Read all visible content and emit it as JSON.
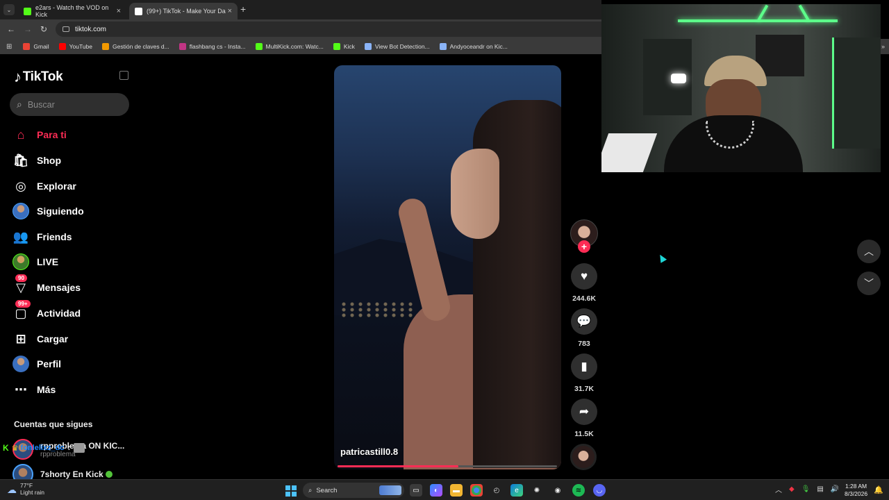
{
  "browser": {
    "tabs": [
      {
        "title": "e2ars - Watch the VOD on Kick",
        "favicon_color": "#53fc18"
      },
      {
        "title": "(99+) TikTok - Make Your Da",
        "favicon_color": "#ffffff"
      }
    ],
    "new_tab": "+",
    "close_glyph": "×",
    "url": "tiktok.com",
    "bookmarks": [
      {
        "label": "Gmail",
        "color": "#ea4335"
      },
      {
        "label": "YouTube",
        "color": "#ff0000"
      },
      {
        "label": "Gestión de claves d...",
        "color": "#f29900"
      },
      {
        "label": "flashbang cs - Insta...",
        "color": "#c13584"
      },
      {
        "label": "MultiKick.com: Watc...",
        "color": "#53fc18"
      },
      {
        "label": "Kick",
        "color": "#53fc18"
      },
      {
        "label": "View Bot Detection...",
        "color": "#8ab4f8"
      },
      {
        "label": "Andyoceandr on Kic...",
        "color": "#8ab4f8"
      }
    ]
  },
  "tiktok": {
    "logo": "TikTok",
    "search_placeholder": "Buscar",
    "nav": [
      {
        "label": "Para ti",
        "icon": "home-icon",
        "active": true
      },
      {
        "label": "Shop",
        "icon": "shop-icon"
      },
      {
        "label": "Explorar",
        "icon": "compass-icon"
      },
      {
        "label": "Siguiendo",
        "icon": "following-avatar-icon"
      },
      {
        "label": "Friends",
        "icon": "friends-icon"
      },
      {
        "label": "LIVE",
        "icon": "live-icon"
      },
      {
        "label": "Mensajes",
        "icon": "messages-icon",
        "badge": "90"
      },
      {
        "label": "Actividad",
        "icon": "activity-icon",
        "badge": "99+"
      },
      {
        "label": "Cargar",
        "icon": "upload-icon"
      },
      {
        "label": "Perfil",
        "icon": "profile-avatar-icon"
      },
      {
        "label": "Más",
        "icon": "more-icon"
      }
    ],
    "following_title": "Cuentas que sigues",
    "following": [
      {
        "name": "rpproblema ON KIC...",
        "handle": "rpproblema"
      },
      {
        "name": "7shorty En Kick",
        "handle": ""
      }
    ],
    "video": {
      "author": "patricastill0.8",
      "progress": 0.55,
      "likes": "244.6K",
      "comments": "783",
      "saves": "31.7K",
      "shares": "11.5K"
    }
  },
  "stream_chat": {
    "username": "fonlelixz_dc",
    "separator": ":"
  },
  "taskbar": {
    "weather_temp": "77°F",
    "weather_desc": "Light rain",
    "search_label": "Search",
    "time": "1:28 AM",
    "date": "8/3/2026"
  }
}
